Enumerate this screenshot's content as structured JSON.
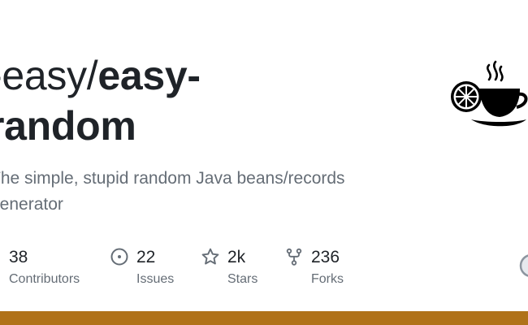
{
  "repo": {
    "owner": "-easy/",
    "name_line1": "easy-",
    "name_line2": "random",
    "description": "The simple, stupid random Java beans/records generator"
  },
  "stats": {
    "contributors": {
      "value": "38",
      "label": "Contributors",
      "icon": "people-icon"
    },
    "issues": {
      "value": "22",
      "label": "Issues",
      "icon": "issue-opened-icon"
    },
    "stars": {
      "value": "2k",
      "label": "Stars",
      "icon": "star-icon"
    },
    "forks": {
      "value": "236",
      "label": "Forks",
      "icon": "repo-forked-icon"
    }
  },
  "logo": {
    "icon": "tea-cup-lemon-logo"
  },
  "colors": {
    "title": "#1f2328",
    "muted": "#656d76",
    "icon": "#656d76",
    "language_bar": "#b07219"
  }
}
